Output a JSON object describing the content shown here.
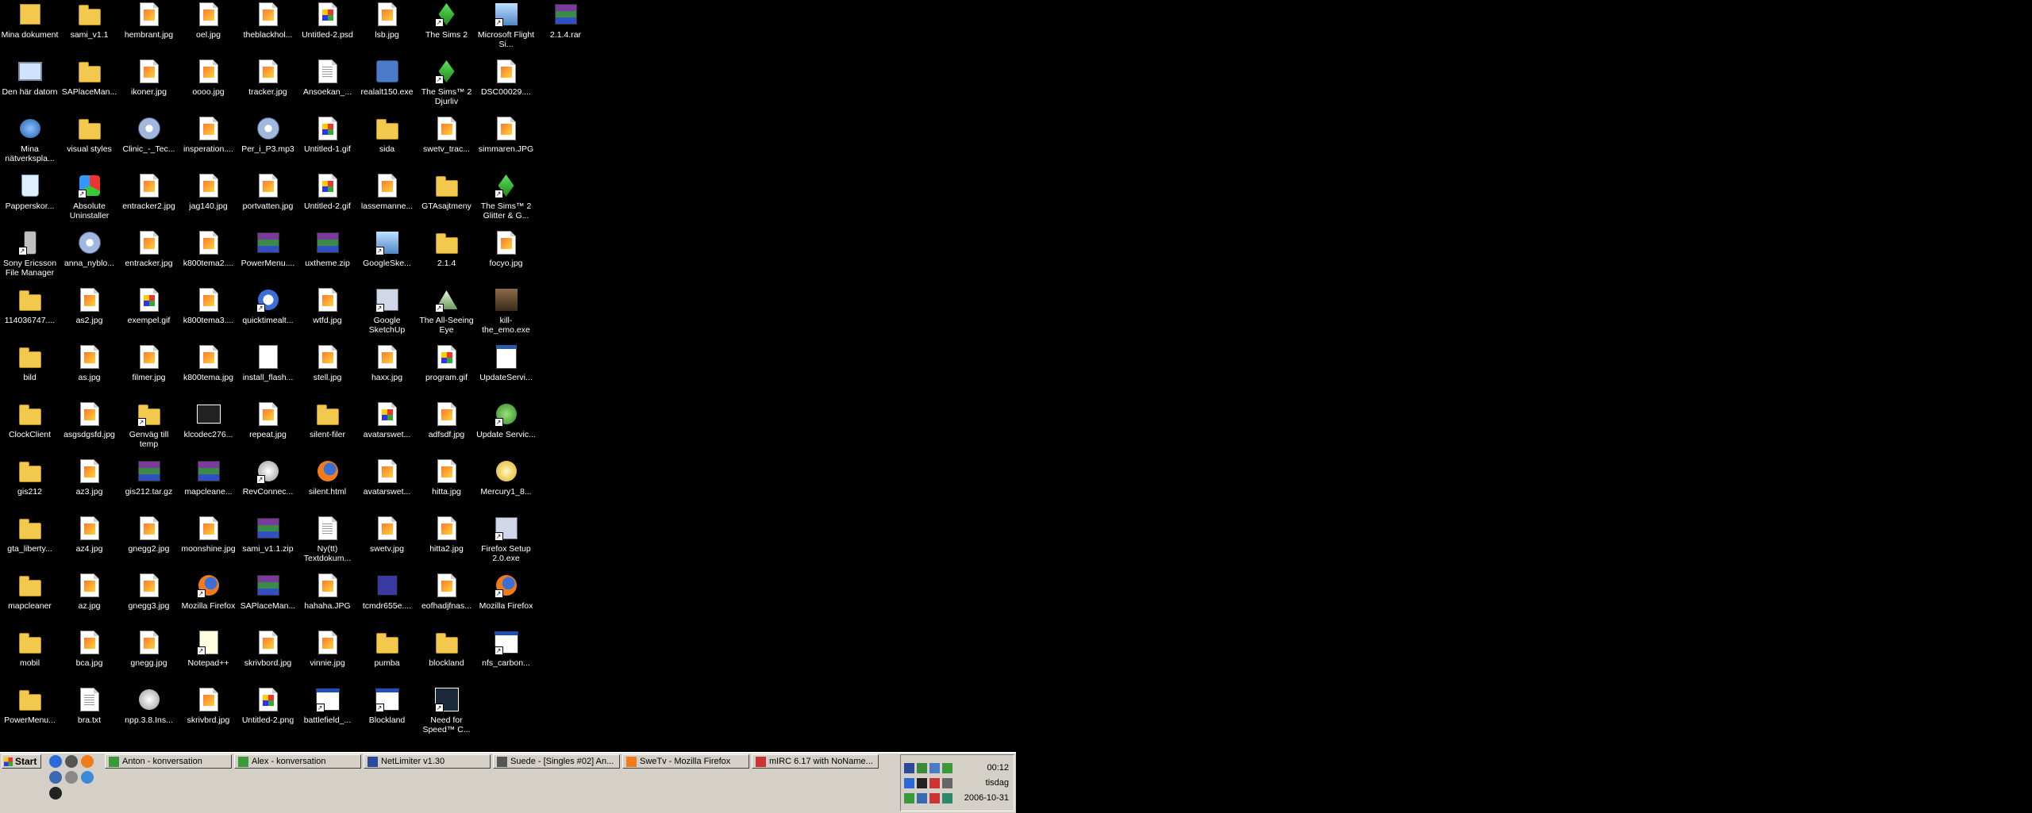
{
  "desktop": {
    "icons": [
      {
        "label": "Mina dokument",
        "icon": "my-documents-icon",
        "kind": "docs"
      },
      {
        "label": "sami_v1.1",
        "icon": "folder-icon",
        "kind": "folder"
      },
      {
        "label": "hembrant.jpg",
        "icon": "image-file-icon",
        "kind": "image"
      },
      {
        "label": "oel.jpg",
        "icon": "image-file-icon",
        "kind": "image"
      },
      {
        "label": "theblackhol...",
        "icon": "image-file-icon",
        "kind": "image"
      },
      {
        "label": "Untitled-2.psd",
        "icon": "psd-file-icon",
        "kind": "gif"
      },
      {
        "label": "lsb.jpg",
        "icon": "image-file-icon",
        "kind": "image"
      },
      {
        "label": "The Sims 2",
        "icon": "sims-icon",
        "kind": "sims"
      },
      {
        "label": "Microsoft Flight Si...",
        "icon": "flight-sim-icon",
        "kind": "sky"
      },
      {
        "label": "2.1.4.rar",
        "icon": "rar-archive-icon",
        "kind": "rar"
      },
      {
        "label": "Den här datorn",
        "icon": "my-computer-icon",
        "kind": "computer"
      },
      {
        "label": "SAPlaceMan...",
        "icon": "folder-icon",
        "kind": "folder"
      },
      {
        "label": "ikoner.jpg",
        "icon": "image-file-icon",
        "kind": "image"
      },
      {
        "label": "oooo.jpg",
        "icon": "image-file-icon",
        "kind": "image"
      },
      {
        "label": "tracker.jpg",
        "icon": "image-file-icon",
        "kind": "image"
      },
      {
        "label": "Ansoekan_...",
        "icon": "word-document-icon",
        "kind": "text"
      },
      {
        "label": "realalt150.exe",
        "icon": "real-player-icon",
        "kind": "app"
      },
      {
        "label": "The Sims™ 2 Djurliv",
        "icon": "sims-icon",
        "kind": "sims"
      },
      {
        "label": "DSC00029....",
        "icon": "image-file-icon",
        "kind": "image"
      },
      {
        "label": "Mina nätverkspla...",
        "icon": "network-places-icon",
        "kind": "network"
      },
      {
        "label": "visual styles",
        "icon": "folder-icon",
        "kind": "folder"
      },
      {
        "label": "Clinic_-_Tec...",
        "icon": "media-file-icon",
        "kind": "media"
      },
      {
        "label": "insperation....",
        "icon": "image-file-icon",
        "kind": "image"
      },
      {
        "label": "Per_i_P3.mp3",
        "icon": "media-file-icon",
        "kind": "media"
      },
      {
        "label": "Untitled-1.gif",
        "icon": "gif-file-icon",
        "kind": "gif"
      },
      {
        "label": "sida",
        "icon": "folder-icon",
        "kind": "folder"
      },
      {
        "label": "swetv_trac...",
        "icon": "image-file-icon",
        "kind": "image"
      },
      {
        "label": "simmaren.JPG",
        "icon": "image-file-icon",
        "kind": "image"
      },
      {
        "label": "Papperskor...",
        "icon": "recycle-bin-icon",
        "kind": "recycle"
      },
      {
        "label": "Absolute Uninstaller",
        "icon": "uninstaller-icon",
        "kind": "uninstall"
      },
      {
        "label": "entracker2.jpg",
        "icon": "image-file-icon",
        "kind": "image"
      },
      {
        "label": "jag140.jpg",
        "icon": "image-file-icon",
        "kind": "image"
      },
      {
        "label": "portvatten.jpg",
        "icon": "image-file-icon",
        "kind": "image"
      },
      {
        "label": "Untitled-2.gif",
        "icon": "gif-file-icon",
        "kind": "gif"
      },
      {
        "label": "lassemanne...",
        "icon": "image-file-icon",
        "kind": "image"
      },
      {
        "label": "GTAsajtmeny",
        "icon": "folder-icon",
        "kind": "folder"
      },
      {
        "label": "The Sims™ 2 Glitter & G...",
        "icon": "sims-icon",
        "kind": "sims"
      },
      {
        "label": "Sony Ericsson File Manager",
        "icon": "phone-icon",
        "kind": "phone"
      },
      {
        "label": "anna_nyblo...",
        "icon": "media-file-icon",
        "kind": "media"
      },
      {
        "label": "entracker.jpg",
        "icon": "image-file-icon",
        "kind": "image"
      },
      {
        "label": "k800tema2....",
        "icon": "image-file-icon",
        "kind": "image"
      },
      {
        "label": "PowerMenu....",
        "icon": "rar-archive-icon",
        "kind": "rar"
      },
      {
        "label": "uxtheme.zip",
        "icon": "rar-archive-icon",
        "kind": "rar"
      },
      {
        "label": "GoogleSke...",
        "icon": "sketchup-icon",
        "kind": "sky"
      },
      {
        "label": "2.1.4",
        "icon": "folder-icon",
        "kind": "folder"
      },
      {
        "label": "focyo.jpg",
        "icon": "image-file-icon",
        "kind": "image"
      },
      {
        "label": "114036747....",
        "icon": "folder-icon",
        "kind": "folder"
      },
      {
        "label": "as2.jpg",
        "icon": "image-file-icon",
        "kind": "image"
      },
      {
        "label": "exempel.gif",
        "icon": "gif-file-icon",
        "kind": "gif"
      },
      {
        "label": "k800tema3....",
        "icon": "image-file-icon",
        "kind": "image"
      },
      {
        "label": "quicktimealt...",
        "icon": "quicktime-icon",
        "kind": "quicktime"
      },
      {
        "label": "wtfd.jpg",
        "icon": "image-file-icon",
        "kind": "image"
      },
      {
        "label": "Google SketchUp",
        "icon": "sketchup-icon",
        "kind": "wrench"
      },
      {
        "label": "The All-Seeing Eye",
        "icon": "all-seeing-eye-icon",
        "kind": "eye"
      },
      {
        "label": "kill-the_emo.exe",
        "icon": "person-image-icon",
        "kind": "person"
      },
      {
        "label": "bild",
        "icon": "folder-icon",
        "kind": "folder"
      },
      {
        "label": "as.jpg",
        "icon": "image-file-icon",
        "kind": "image"
      },
      {
        "label": "filmer.jpg",
        "icon": "image-file-icon",
        "kind": "image"
      },
      {
        "label": "k800tema.jpg",
        "icon": "image-file-icon",
        "kind": "image"
      },
      {
        "label": "install_flash...",
        "icon": "flash-installer-icon",
        "kind": "flash"
      },
      {
        "label": "stell.jpg",
        "icon": "image-file-icon",
        "kind": "image"
      },
      {
        "label": "haxx.jpg",
        "icon": "image-file-icon",
        "kind": "image"
      },
      {
        "label": "program.gif",
        "icon": "gif-file-icon",
        "kind": "gif"
      },
      {
        "label": "UpdateServi...",
        "icon": "update-service-icon",
        "kind": "update"
      },
      {
        "label": "ClockClient",
        "icon": "folder-icon",
        "kind": "folder"
      },
      {
        "label": "asgsdgsfd.jpg",
        "icon": "image-file-icon",
        "kind": "image"
      },
      {
        "label": "Genväg till temp",
        "icon": "folder-shortcut-icon",
        "kind": "folder"
      },
      {
        "label": "klcodec276...",
        "icon": "codec-clapper-icon",
        "kind": "clapper"
      },
      {
        "label": "repeat.jpg",
        "icon": "image-file-icon",
        "kind": "image"
      },
      {
        "label": "silent-filer",
        "icon": "folder-icon",
        "kind": "folder"
      },
      {
        "label": "avatarswet...",
        "icon": "gif-file-icon",
        "kind": "gif"
      },
      {
        "label": "adfsdf.jpg",
        "icon": "image-file-icon",
        "kind": "image"
      },
      {
        "label": "Update Servic...",
        "icon": "update-service-icon",
        "kind": "green"
      },
      {
        "label": "gis212",
        "icon": "folder-icon",
        "kind": "folder"
      },
      {
        "label": "az3.jpg",
        "icon": "image-file-icon",
        "kind": "image"
      },
      {
        "label": "gis212.tar.gz",
        "icon": "rar-archive-icon",
        "kind": "rar"
      },
      {
        "label": "mapcleane...",
        "icon": "rar-archive-icon",
        "kind": "rar"
      },
      {
        "label": "RevConnec...",
        "icon": "revconnect-icon",
        "kind": "globe"
      },
      {
        "label": "silent.html",
        "icon": "firefox-html-icon",
        "kind": "firefox"
      },
      {
        "label": "avatarswet...",
        "icon": "image-file-icon",
        "kind": "image"
      },
      {
        "label": "hitta.jpg",
        "icon": "image-file-icon",
        "kind": "image"
      },
      {
        "label": "Mercury1_8...",
        "icon": "mercury-icon",
        "kind": "mercury"
      },
      {
        "label": "gta_liberty...",
        "icon": "folder-icon",
        "kind": "folder"
      },
      {
        "label": "az4.jpg",
        "icon": "image-file-icon",
        "kind": "image"
      },
      {
        "label": "gnegg2.jpg",
        "icon": "image-file-icon",
        "kind": "image"
      },
      {
        "label": "moonshine.jpg",
        "icon": "image-file-icon",
        "kind": "image"
      },
      {
        "label": "sami_v1.1.zip",
        "icon": "rar-archive-icon",
        "kind": "rar"
      },
      {
        "label": "Ny(tt) Textdokum...",
        "icon": "text-document-icon",
        "kind": "text"
      },
      {
        "label": "swetv.jpg",
        "icon": "image-file-icon",
        "kind": "image"
      },
      {
        "label": "hitta2.jpg",
        "icon": "image-file-icon",
        "kind": "image"
      },
      {
        "label": "Firefox Setup 2.0.exe",
        "icon": "firefox-setup-icon",
        "kind": "wrench"
      },
      {
        "label": "mapcleaner",
        "icon": "folder-icon",
        "kind": "folder"
      },
      {
        "label": "az.jpg",
        "icon": "image-file-icon",
        "kind": "image"
      },
      {
        "label": "gnegg3.jpg",
        "icon": "image-file-icon",
        "kind": "image"
      },
      {
        "label": "Mozilla Firefox",
        "icon": "firefox-icon",
        "kind": "firefox"
      },
      {
        "label": "SAPlaceMan...",
        "icon": "rar-archive-icon",
        "kind": "rar"
      },
      {
        "label": "hahaha.JPG",
        "icon": "image-file-icon",
        "kind": "image"
      },
      {
        "label": "tcmdr655e....",
        "icon": "save-disk-icon",
        "kind": "save"
      },
      {
        "label": "eofhadjfnas...",
        "icon": "image-file-icon",
        "kind": "image"
      },
      {
        "label": "Mozilla Firefox",
        "icon": "firefox-icon",
        "kind": "firefox"
      },
      {
        "label": "mobil",
        "icon": "folder-icon",
        "kind": "folder"
      },
      {
        "label": "bca.jpg",
        "icon": "image-file-icon",
        "kind": "image"
      },
      {
        "label": "gnegg.jpg",
        "icon": "image-file-icon",
        "kind": "image"
      },
      {
        "label": "Notepad++",
        "icon": "notepad-plus-icon",
        "kind": "notepad"
      },
      {
        "label": "skrivbord.jpg",
        "icon": "image-file-icon",
        "kind": "image"
      },
      {
        "label": "vinnie.jpg",
        "icon": "image-file-icon",
        "kind": "image"
      },
      {
        "label": "pumba",
        "icon": "folder-icon",
        "kind": "folder"
      },
      {
        "label": "blockland",
        "icon": "folder-icon",
        "kind": "folder"
      },
      {
        "label": "nfs_carbon...",
        "icon": "window-icon",
        "kind": "window"
      },
      {
        "label": "PowerMenu...",
        "icon": "folder-icon",
        "kind": "folder"
      },
      {
        "label": "bra.txt",
        "icon": "text-file-icon",
        "kind": "text"
      },
      {
        "label": "npp.3.8.Ins...",
        "icon": "installer-disc-icon",
        "kind": "globe"
      },
      {
        "label": "skrivbrd.jpg",
        "icon": "image-file-icon",
        "kind": "image"
      },
      {
        "label": "Untitled-2.png",
        "icon": "image-file-icon",
        "kind": "gif"
      },
      {
        "label": "battlefield_...",
        "icon": "window-icon",
        "kind": "window"
      },
      {
        "label": "Blockland",
        "icon": "window-icon",
        "kind": "window"
      },
      {
        "label": "Need for Speed™ C...",
        "icon": "need-for-speed-icon",
        "kind": "nfs"
      }
    ]
  },
  "taskbar": {
    "start_label": "Start",
    "quick_launch": [
      {
        "icon": "ie-icon"
      },
      {
        "icon": "media-player-icon"
      },
      {
        "icon": "firefox-icon"
      },
      {
        "icon": "desktop-icon"
      },
      {
        "icon": "media-icon"
      },
      {
        "icon": "update-icon"
      },
      {
        "icon": "clock-icon"
      }
    ],
    "tasks": [
      {
        "label": "Anton - konversation",
        "icon": "messenger-icon"
      },
      {
        "label": "Alex - konversation",
        "icon": "messenger-icon"
      },
      {
        "label": "NetLimiter v1.30",
        "icon": "netlimiter-icon"
      },
      {
        "label": "Suede - [Singles #02] An...",
        "icon": "media-player-icon"
      },
      {
        "label": "SweTv - Mozilla Firefox",
        "icon": "firefox-icon"
      },
      {
        "label": "mIRC 6.17 with NoName...",
        "icon": "mirc-icon"
      }
    ],
    "tray": {
      "time": "00:12",
      "day": "tisdag",
      "date": "2006-10-31"
    }
  },
  "colors": {
    "desktop_bg": "#000000",
    "taskbar_bg": "#d4d0c8",
    "icon_text": "#ffffff"
  }
}
